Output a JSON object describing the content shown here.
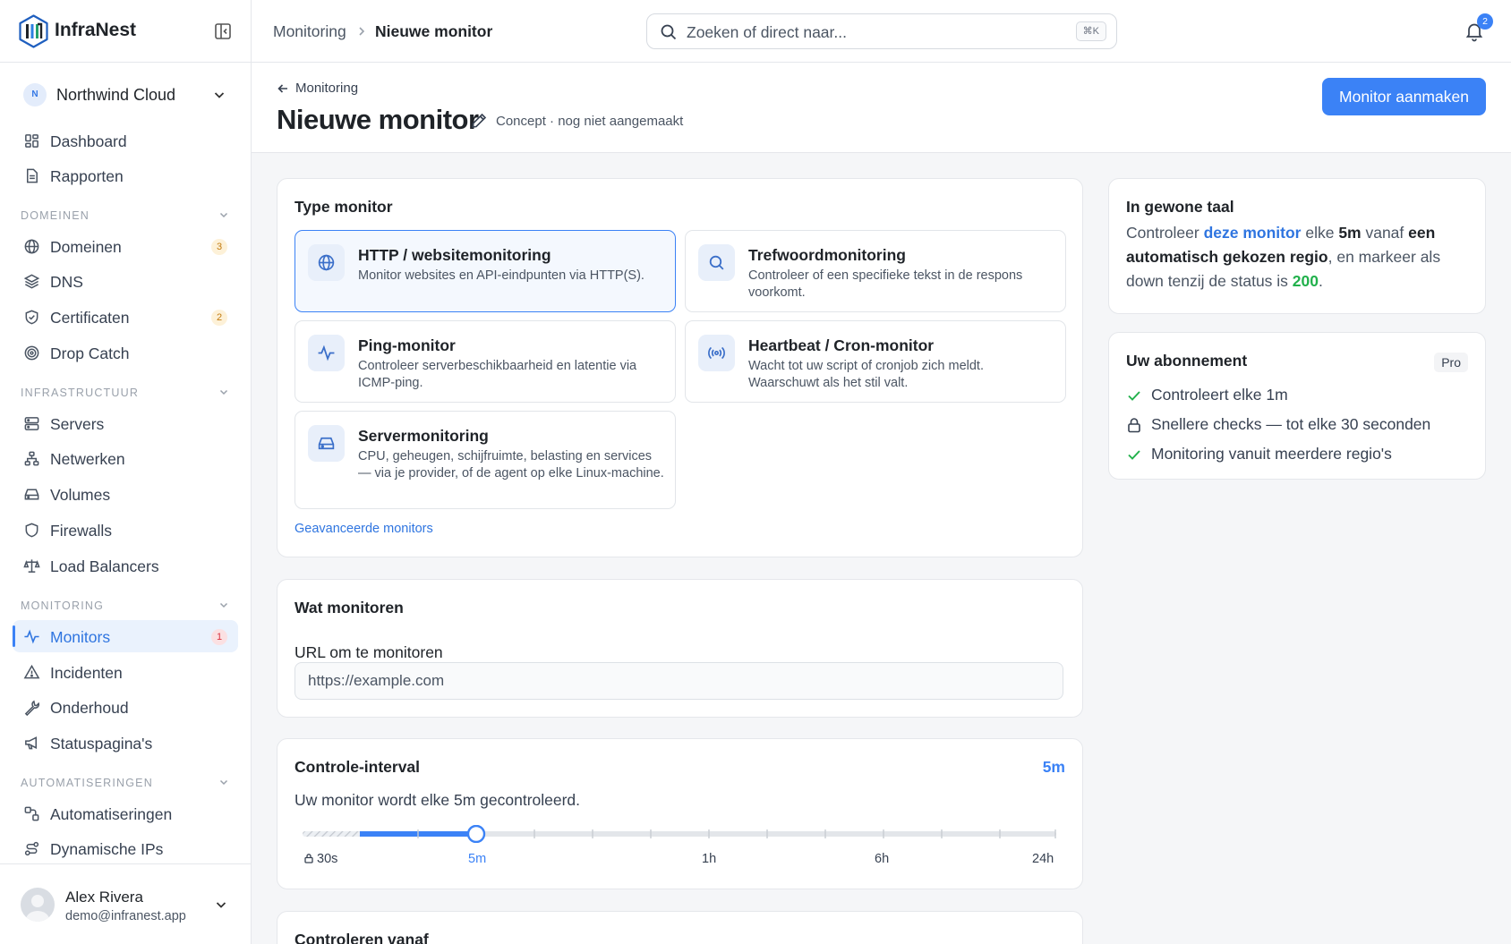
{
  "app": {
    "name": "InfraNest"
  },
  "org": {
    "initial": "N",
    "name": "Northwind Cloud"
  },
  "nav": {
    "dashboard": "Dashboard",
    "reports": "Rapporten",
    "sections": {
      "domains": "DOMEINEN",
      "infra": "INFRASTRUCTUUR",
      "monitoring": "MONITORING",
      "automation": "AUTOMATISERINGEN"
    },
    "domains": "Domeinen",
    "domains_badge": "3",
    "dns": "DNS",
    "certificates": "Certificaten",
    "certificates_badge": "2",
    "drop_catch": "Drop Catch",
    "servers": "Servers",
    "networks": "Netwerken",
    "volumes": "Volumes",
    "firewalls": "Firewalls",
    "load_balancers": "Load Balancers",
    "monitors": "Monitors",
    "monitors_badge": "1",
    "incidents": "Incidenten",
    "maintenance": "Onderhoud",
    "status_pages": "Statuspagina's",
    "automations": "Automatiseringen",
    "dynamic_ips": "Dynamische IPs"
  },
  "user": {
    "name": "Alex Rivera",
    "email": "demo@infranest.app"
  },
  "topbar": {
    "breadcrumb_parent": "Monitoring",
    "breadcrumb_current": "Nieuwe monitor",
    "search_placeholder": "Zoeken of direct naar...",
    "search_shortcut": "⌘K",
    "notifications_count": "2"
  },
  "header": {
    "back_label": "Monitoring",
    "title": "Nieuwe monitor",
    "status": "Concept · nog niet aangemaakt",
    "create_button": "Monitor aanmaken"
  },
  "type_card": {
    "title": "Type monitor",
    "options": [
      {
        "name": "HTTP / websitemonitoring",
        "desc": "Monitor websites en API-eindpunten via HTTP(S).",
        "icon": "globe-icon",
        "selected": true
      },
      {
        "name": "Trefwoordmonitoring",
        "desc": "Controleer of een specifieke tekst in de respons voorkomt.",
        "icon": "search-icon",
        "selected": false
      },
      {
        "name": "Ping-monitor",
        "desc": "Controleer serverbeschikbaarheid en latentie via ICMP-ping.",
        "icon": "pulse-icon",
        "selected": false
      },
      {
        "name": "Heartbeat / Cron-monitor",
        "desc": "Wacht tot uw script of cronjob zich meldt. Waarschuwt als het stil valt.",
        "icon": "broadcast-icon",
        "selected": false
      },
      {
        "name": "Servermonitoring",
        "desc": "CPU, geheugen, schijfruimte, belasting en services — via je provider, of de agent op elke Linux-machine.",
        "icon": "hard-drive-icon",
        "selected": false
      }
    ],
    "advanced_link": "Geavanceerde monitors"
  },
  "what_card": {
    "title": "Wat monitoren",
    "url_label": "URL om te monitoren",
    "url_placeholder": "https://example.com",
    "url_value": ""
  },
  "interval_card": {
    "title": "Controle-interval",
    "value": "5m",
    "description": "Uw monitor wordt elke 5m gecontroleerd.",
    "tick_labels": [
      "30s",
      "5m",
      "1h",
      "6h",
      "24h"
    ],
    "selected_label": "5m",
    "locked_label": "30s"
  },
  "next_card": {
    "title": "Controleren vanaf"
  },
  "plain_card": {
    "title": "In gewone taal",
    "p1": "Controleer ",
    "link": "deze monitor",
    "p2": " elke ",
    "interval": "5m",
    "p3": " vanaf ",
    "region": "een automatisch gekozen regio",
    "p4": ", en markeer als down tenzij de status is ",
    "status_code": "200",
    "p5": "."
  },
  "plan_card": {
    "title": "Uw abonnement",
    "badge": "Pro",
    "features": [
      {
        "text": "Controleert elke 1m",
        "icon": "check-icon"
      },
      {
        "text": "Snellere checks — tot elke 30 seconden",
        "icon": "lock-icon"
      },
      {
        "text": "Monitoring vanuit meerdere regio's",
        "icon": "check-icon"
      }
    ]
  },
  "colors": {
    "accent": "#3b82f6",
    "success": "#22b14c",
    "warning": "#c27a0e",
    "danger": "#d93240"
  }
}
